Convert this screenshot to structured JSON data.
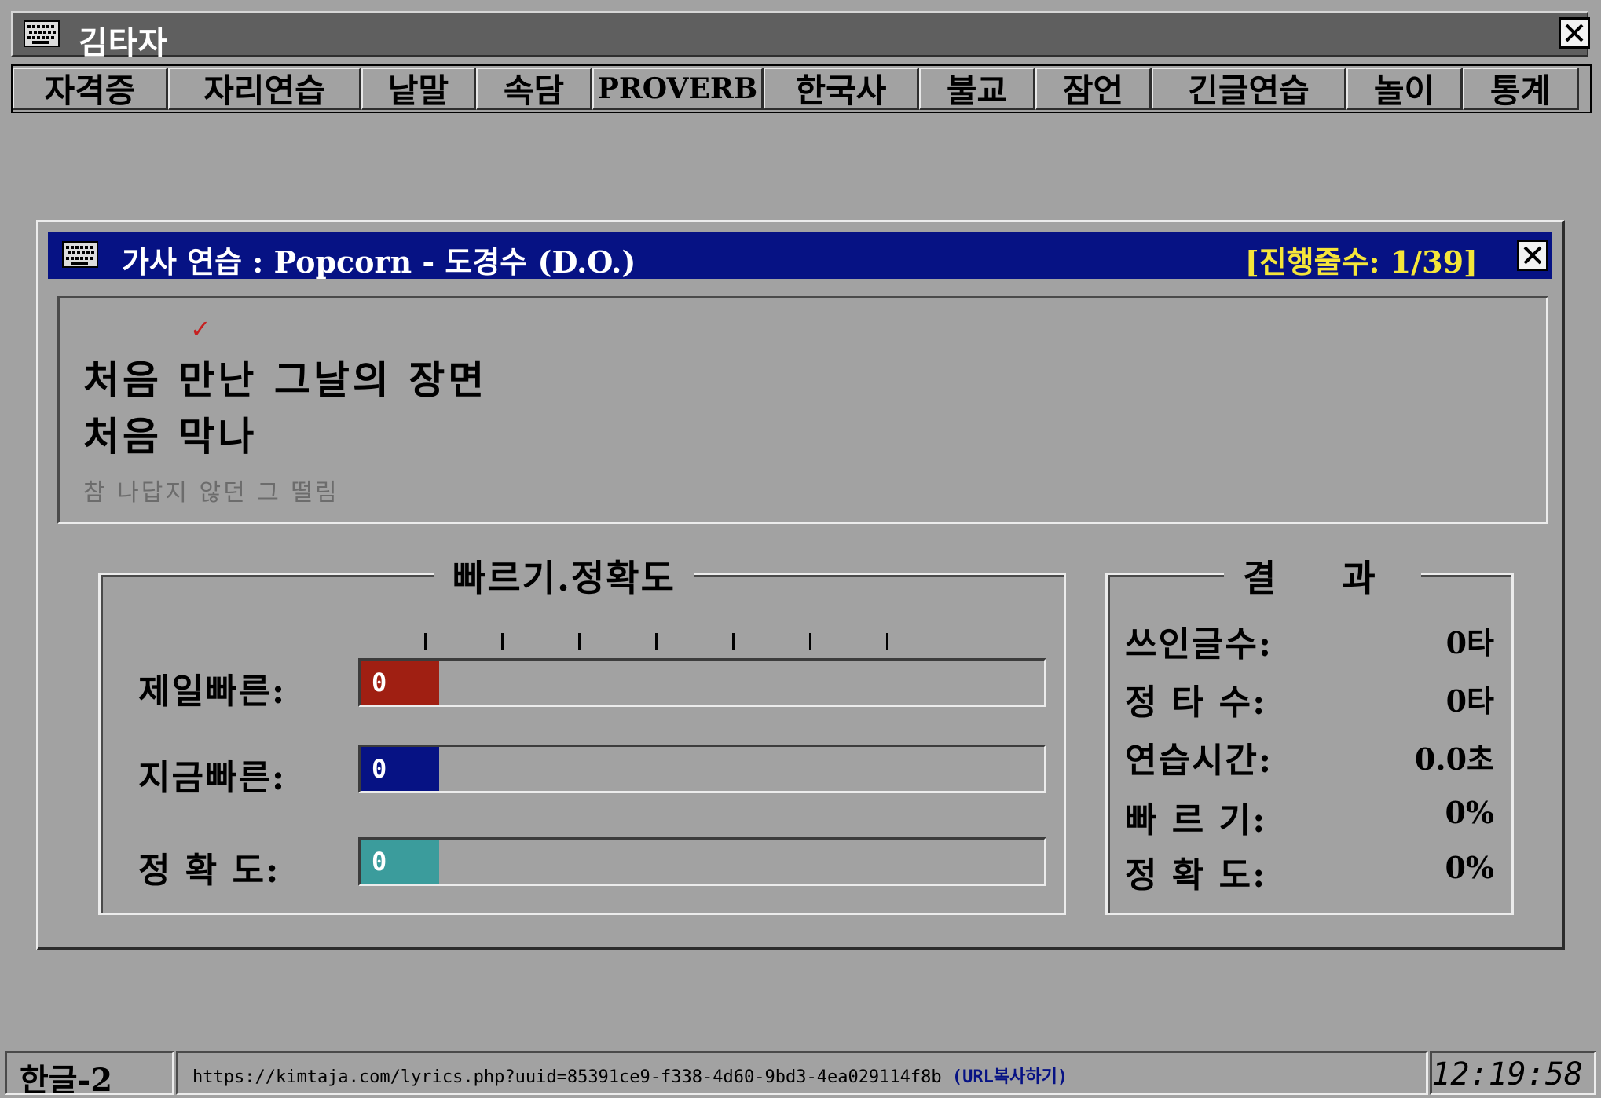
{
  "app": {
    "title": "김타자",
    "menu": [
      {
        "label": "자격증"
      },
      {
        "label": "자리연습"
      },
      {
        "label": "낱말"
      },
      {
        "label": "속담"
      },
      {
        "label": "PROVERB"
      },
      {
        "label": "한국사"
      },
      {
        "label": "불교"
      },
      {
        "label": "잠언"
      },
      {
        "label": "긴글연습"
      },
      {
        "label": "놀이"
      },
      {
        "label": "통계"
      }
    ]
  },
  "dialog": {
    "title": "가사 연습 : Popcorn - 도경수 (D.O.)",
    "progress": "[진행줄수: 1/39]",
    "lyrics": {
      "current": "처음 만난 그날의 장면",
      "next": "처음 막나",
      "upcoming": "참 나답지 않던 그 떨림"
    },
    "speed_group": {
      "title": "빠르기.정확도",
      "bars": [
        {
          "label": "제일빠른:",
          "value": "0",
          "color": "#a01f12",
          "fill_fraction": 0
        },
        {
          "label": "지금빠른:",
          "value": "0",
          "color": "#061284",
          "fill_fraction": 0
        },
        {
          "label": "정 확 도:",
          "value": "0",
          "color": "#3b9c9c",
          "fill_fraction": 0
        }
      ]
    },
    "result_group": {
      "title": "결 과",
      "rows": [
        {
          "label": "쓰인글수:",
          "value": "0타"
        },
        {
          "label": "정 타 수:",
          "value": "0타"
        },
        {
          "label": "연습시간:",
          "value": "0.0초"
        },
        {
          "label": "빠 르 기:",
          "value": "0%"
        },
        {
          "label": "정 확 도:",
          "value": "0%"
        }
      ]
    }
  },
  "statusbar": {
    "ime": "한글-2",
    "url": "https://kimtaja.com/lyrics.php?uuid=85391ce9-f338-4d60-9bd3-4ea029114f8b",
    "copy_label": "(URL복사하기)",
    "time": "12:19:58"
  }
}
